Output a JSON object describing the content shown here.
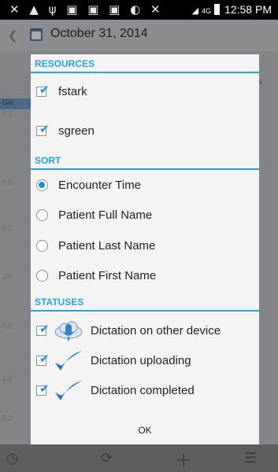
{
  "status_bar": {
    "time": "12:58 PM",
    "network": "4G",
    "icons": [
      "missed-call-icon",
      "warning-icon",
      "usb-icon",
      "gallery-icon",
      "voicemail-icon",
      "sim-icon",
      "sync-icon",
      "mute-icon",
      "wifi-icon",
      "signal-icon",
      "battery-icon"
    ]
  },
  "app_bar": {
    "date": "October 31, 2014"
  },
  "background": {
    "tab_label": "Gle",
    "right_fragment": "s",
    "times": [
      "6:0",
      "8:0",
      "9:0",
      "10:",
      "3:0",
      "4:0",
      "5:0"
    ]
  },
  "dialog": {
    "resources": {
      "header": "RESOURCES",
      "items": [
        {
          "label": "fstark",
          "checked": true
        },
        {
          "label": "sgreen",
          "checked": true
        }
      ]
    },
    "sort": {
      "header": "SORT",
      "options": [
        {
          "label": "Encounter Time",
          "selected": true
        },
        {
          "label": "Patient Full Name",
          "selected": false
        },
        {
          "label": "Patient Last Name",
          "selected": false
        },
        {
          "label": "Patient First Name",
          "selected": false
        }
      ]
    },
    "statuses": {
      "header": "STATUSES",
      "items": [
        {
          "label": "Dictation on other device",
          "checked": true,
          "icon": "cloud-microphone-icon"
        },
        {
          "label": "Dictation uploading",
          "checked": true,
          "icon": "checkmark-icon"
        },
        {
          "label": "Dictation completed",
          "checked": true,
          "icon": "checkmark-icon"
        }
      ]
    },
    "ok_label": "OK"
  },
  "nav_bar": {
    "icons": [
      "clock-icon",
      "refresh-icon",
      "add-icon",
      "menu-icon"
    ]
  },
  "colors": {
    "accent": "#28a3df",
    "checkbox_tick": "#1e8fd6",
    "dialog_bg": "#f4f4f4"
  }
}
